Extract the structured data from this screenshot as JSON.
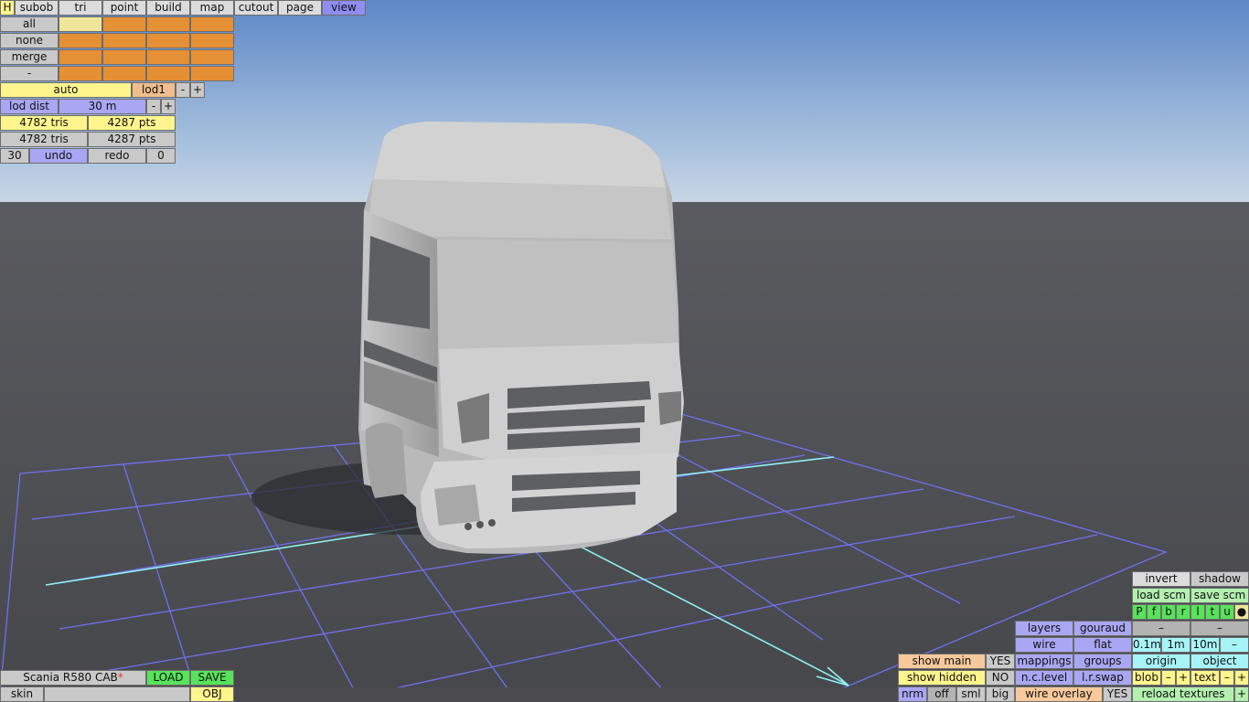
{
  "toolbar": {
    "h": "H",
    "tabs": [
      "subob",
      "tri",
      "point",
      "build",
      "map",
      "cutout",
      "page",
      "view"
    ],
    "active_tab": "view"
  },
  "subobject": {
    "all": "all",
    "none": "none",
    "merge": "merge",
    "minus": "-"
  },
  "lod": {
    "auto": "auto",
    "current": "lod1",
    "minus": "-",
    "plus": "+",
    "dist_label": "lod dist",
    "dist_value": "30 m"
  },
  "stats": {
    "tris_total": "4782 tris",
    "pts_total": "4287 pts",
    "tris_sel": "4782 tris",
    "pts_sel": "4287 pts"
  },
  "undo": {
    "count": "30",
    "undo": "undo",
    "redo": "redo",
    "redo_count": "0"
  },
  "model": {
    "name": "Scania R580 CAB",
    "modified_mark": "*",
    "load": "LOAD",
    "save": "SAVE",
    "skin": "skin",
    "skin_value": "",
    "obj": "OBJ"
  },
  "display": {
    "show_main": "show main",
    "show_main_val": "YES",
    "show_hidden": "show hidden",
    "show_hidden_val": "NO",
    "nrm": "nrm",
    "off": "off",
    "sml": "sml",
    "big": "big",
    "wire_overlay": "wire overlay",
    "wire_overlay_val": "YES"
  },
  "panel": {
    "layers": "layers",
    "gouraud": "gouraud",
    "wire": "wire",
    "flat": "flat",
    "mappings": "mappings",
    "groups": "groups",
    "nc_level": "n.c.level",
    "lr_swap": "l.r.swap",
    "invert": "invert",
    "shadow": "shadow",
    "load_scm": "load scm",
    "save_scm": "save scm",
    "letters": [
      "P",
      "f",
      "b",
      "r",
      "l",
      "t",
      "u"
    ],
    "dot": "●",
    "dash": "–",
    "grid_01": "0.1m",
    "grid_1": "1m",
    "grid_10": "10m",
    "grid_minus": "–",
    "origin": "origin",
    "object": "object",
    "blob": "blob",
    "text": "text",
    "minus": "–",
    "plus": "+",
    "reload_textures": "reload textures"
  }
}
